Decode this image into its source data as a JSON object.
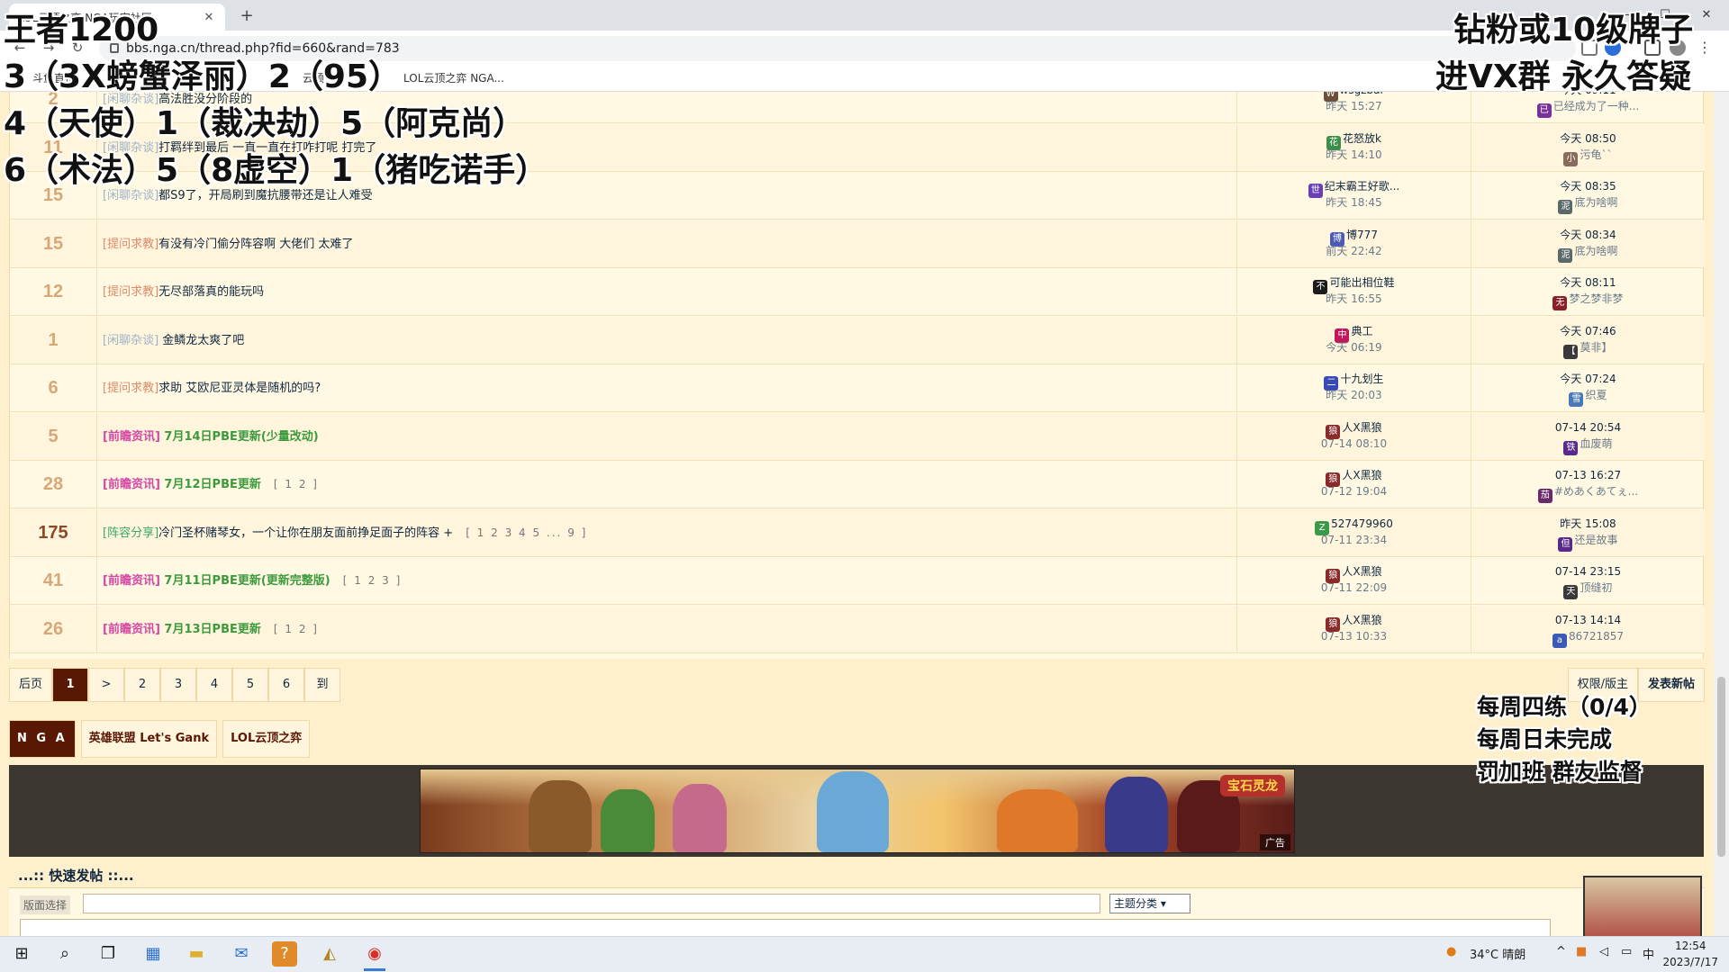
{
  "browser": {
    "tab_title": "LOL云顶之弈 NGA玩家社区",
    "url": "bbs.nga.cn/thread.php?fid=660&rand=783",
    "bookmarks": [
      "斗鱼直播",
      "云顶",
      "LOL云顶之弈 NGA..."
    ]
  },
  "topics": [
    {
      "replies": "2",
      "category": "[闲聊杂谈]",
      "cat_class": "chat",
      "title": "高法胜没分阶段的 ",
      "title_style": "",
      "pages": "",
      "author": "wsgzbar",
      "author_av": "W",
      "author_color": "#6b4f3a",
      "author_time": "昨天 15:27",
      "last_time": "今天 09:11",
      "last_user": "已经成为了一种...",
      "last_av": "已",
      "last_color": "#7a2f9a"
    },
    {
      "replies": "11",
      "category": "[闲聊杂谈]",
      "cat_class": "chat",
      "title": "打羁绊到最后 一直一直在打咋打呢 打完了 ",
      "title_style": "",
      "pages": "",
      "author": "花怒放k",
      "author_av": "花",
      "author_color": "#3b8f4a",
      "author_time": "昨天 14:10",
      "last_time": "今天 08:50",
      "last_user": "污龟``",
      "last_av": "小",
      "last_color": "#8a6a5a"
    },
    {
      "replies": "15",
      "category": "[闲聊杂谈]",
      "cat_class": "chat",
      "title": "都S9了，开局刷到魔抗腰带还是让人难受",
      "title_style": "",
      "pages": "",
      "author": "纪末霸王好歌...",
      "author_av": "世",
      "author_color": "#6a3fb5",
      "author_time": "昨天 18:45",
      "last_time": "今天 08:35",
      "last_user": "底为啥啊",
      "last_av": "泥",
      "last_color": "#5a6a6a"
    },
    {
      "replies": "15",
      "category": "[提问求教]",
      "cat_class": "ask",
      "title": "有没有冷门偷分阵容啊 大佬们 太难了",
      "title_style": "",
      "pages": "",
      "author": "博777",
      "author_av": "博",
      "author_color": "#4a5ab5",
      "author_time": "前天 22:42",
      "last_time": "今天 08:34",
      "last_user": "底为啥啊",
      "last_av": "泥",
      "last_color": "#5a6a6a"
    },
    {
      "replies": "12",
      "category": "[提问求教]",
      "cat_class": "ask",
      "title": "无尽部落真的能玩吗",
      "title_style": "",
      "pages": "",
      "author": "可能出相位鞋",
      "author_av": "不",
      "author_color": "#1b1b1b",
      "author_time": "昨天 16:55",
      "last_time": "今天 08:11",
      "last_user": "梦之梦非梦",
      "last_av": "无",
      "last_color": "#8a1f2a"
    },
    {
      "replies": "1",
      "category": "[闲聊杂谈]",
      "cat_class": "chat",
      "title": " 金鳞龙太爽了吧",
      "title_style": "",
      "pages": "",
      "author": "典工",
      "author_av": "中",
      "author_color": "#c2185b",
      "author_time": "今天 06:19",
      "last_time": "今天 07:46",
      "last_user": "莫非】",
      "last_av": "【",
      "last_color": "#3a3a3a"
    },
    {
      "replies": "6",
      "category": "[提问求教]",
      "cat_class": "ask",
      "title": "求助 艾欧尼亚灵体是随机的吗?",
      "title_style": "",
      "pages": "",
      "author": "十九划生",
      "author_av": "二",
      "author_color": "#3a4ab5",
      "author_time": "昨天 20:03",
      "last_time": "今天 07:24",
      "last_user": "织夏",
      "last_av": "雪",
      "last_color": "#4a7ab5"
    },
    {
      "replies": "5",
      "category": "[前瞻资讯]",
      "cat_class": "news",
      "title": " 7月14日PBE更新(少量改动)",
      "title_style": "green",
      "pages": "",
      "author": "人X黑狼",
      "author_av": "狼",
      "author_color": "#8a2a2a",
      "author_time": "07-14 08:10",
      "last_time": "07-14 20:54",
      "last_user": "血废萌",
      "last_av": "铁",
      "last_color": "#5a2a8a"
    },
    {
      "replies": "28",
      "category": "[前瞻资讯]",
      "cat_class": "news",
      "title": " 7月12日PBE更新",
      "title_style": "green",
      "pages": "[ 1 2 ]",
      "author": "人X黑狼",
      "author_av": "狼",
      "author_color": "#8a2a2a",
      "author_time": "07-12 19:04",
      "last_time": "07-13 16:27",
      "last_user": "#めあくあてぇ...",
      "last_av": "茄",
      "last_color": "#6a2a6a"
    },
    {
      "replies": "175",
      "category": "[阵容分享]",
      "cat_class": "share",
      "title": "冷门圣杯赌琴女，一个让你在朋友面前挣足面子的阵容 +",
      "title_style": "",
      "pages": "[ 1 2 3 4 5 ... 9 ]",
      "author": "527479960",
      "author_av": "Z",
      "author_color": "#3a9a4a",
      "author_time": "07-11 23:34",
      "last_time": "昨天 15:08",
      "last_user": "还是故事",
      "last_av": "但",
      "last_color": "#5a2a8a"
    },
    {
      "replies": "41",
      "category": "[前瞻资讯]",
      "cat_class": "news",
      "title": " 7月11日PBE更新(更新完整版)",
      "title_style": "green",
      "pages": "[ 1 2 3 ]",
      "author": "人X黑狼",
      "author_av": "狼",
      "author_color": "#8a2a2a",
      "author_time": "07-11 22:09",
      "last_time": "07-14 23:15",
      "last_user": "顶缝初",
      "last_av": "天",
      "last_color": "#3a3a3a"
    },
    {
      "replies": "26",
      "category": "[前瞻资讯]",
      "cat_class": "news",
      "title": " 7月13日PBE更新",
      "title_style": "green",
      "pages": "[ 1 2 ]",
      "author": "人X黑狼",
      "author_av": "狼",
      "author_color": "#8a2a2a",
      "author_time": "07-13 10:33",
      "last_time": "07-13 14:14",
      "last_user": "86721857",
      "last_av": "a",
      "last_color": "#3a5ab5"
    }
  ],
  "pager": [
    "后页",
    "1",
    ">",
    "2",
    "3",
    "4",
    "5",
    "6",
    "到"
  ],
  "pager_current": "1",
  "right_buttons": {
    "perm": "权限/版主",
    "post": "发表新帖"
  },
  "crumbs": {
    "logo": "N G A",
    "lol": "英雄联盟 Let's Gank",
    "tft": "LOL云顶之弈"
  },
  "ad": {
    "logo_text": "宝石灵龙",
    "label": "广告"
  },
  "quick_post": {
    "title": "...:: 快速发帖 ::...",
    "label": "版面选择",
    "select": "主题分类"
  },
  "overlay": {
    "line1": "王者1200",
    "line2": "3（3X螃蟹泽丽）2（95）",
    "line3": "4（天使）1（裁决劫）5（阿克尚）",
    "line4": "6（术法）5（8虚空）1（猪吃诺手）",
    "tr1": "钻粉或10级牌子",
    "tr2": "进VX群 永久答疑",
    "br1": "每周四练（0/4）",
    "br2": "每周日未完成",
    "br3": "罚加班 群友监督"
  },
  "taskbar": {
    "weather": "34°C 晴朗",
    "ime": "中",
    "time": "12:54",
    "date": "2023/7/17"
  }
}
